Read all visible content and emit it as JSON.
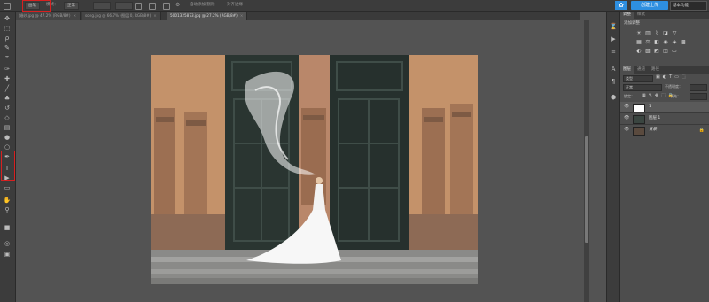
{
  "optbar": {
    "menu_label": "画笔",
    "mode_label": "模式：",
    "mode_value": "正常",
    "opacity_label": "不透明度：",
    "flow_label": "流量：",
    "smooth_label": "平滑",
    "auto_label": "自动添加/删除",
    "align_label": "对齐边缘",
    "cloud_button": "创建上传",
    "workspace": "基本功能"
  },
  "tabs": [
    {
      "label": "婚纱.jpg @ 47.2% (RGB/8#)"
    },
    {
      "label": "song.jpg @ 66.7% (图层 0, RGB/8#)"
    },
    {
      "label": "5001325873.jpg @ 27.2% (RGB/8#)"
    }
  ],
  "tools": [
    "move-tool",
    "marquee-tool",
    "lasso-tool",
    "quick-select-tool",
    "crop-tool",
    "eyedropper-tool",
    "healing-tool",
    "brush-tool",
    "stamp-tool",
    "history-brush-tool",
    "eraser-tool",
    "gradient-tool",
    "blur-tool",
    "dodge-tool",
    "pen-tool",
    "type-tool",
    "path-select-tool",
    "shape-tool",
    "hand-tool",
    "zoom-tool",
    "color-swatches",
    "quick-mask",
    "screen-mode"
  ],
  "tool_glyphs": [
    "✥",
    "⬚",
    "ρ",
    "✎",
    "⌗",
    "✑",
    "✚",
    "╱",
    "♣",
    "↺",
    "◇",
    "▤",
    "●",
    "○",
    "✒",
    "T",
    "▶",
    "▭",
    "✋",
    "⚲",
    "■",
    "◎",
    "▣"
  ],
  "panel": {
    "adjust_tabs": [
      "调整",
      "样式"
    ],
    "adjust_title": "添加调整",
    "layer_tabs": [
      "图层",
      "通道",
      "路径"
    ],
    "kind_filter": "类型",
    "blend_mode": "正常",
    "opacity_label": "不透明度：",
    "fill_label": "填充：",
    "lock_label": "锁定：",
    "layers": [
      {
        "name": "1",
        "selected": true,
        "locked": false
      },
      {
        "name": "图层 1",
        "selected": false,
        "locked": false
      },
      {
        "name": "背景",
        "selected": false,
        "locked": true
      }
    ]
  }
}
